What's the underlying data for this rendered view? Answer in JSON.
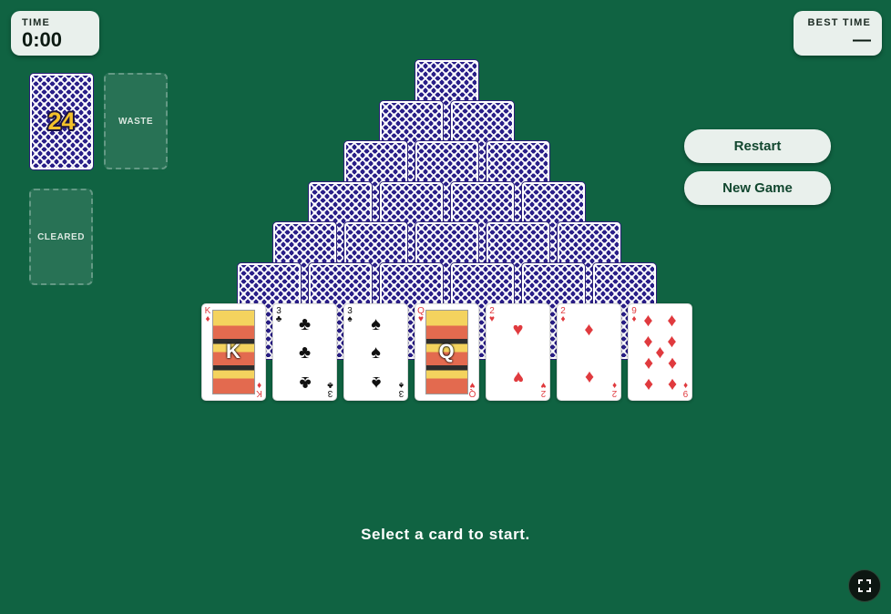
{
  "timer": {
    "label": "TIME",
    "value": "0:00"
  },
  "best_time": {
    "label": "BEST TIME",
    "value": "—"
  },
  "stock": {
    "count": "24"
  },
  "slots": {
    "waste": "WASTE",
    "cleared": "CLEARED"
  },
  "buttons": {
    "restart": "Restart",
    "new_game": "New Game"
  },
  "pyramid": {
    "rows_face_down": 6
  },
  "bottom_row": [
    {
      "rank": "K",
      "suit": "♦",
      "color": "red"
    },
    {
      "rank": "3",
      "suit": "♣",
      "color": "black"
    },
    {
      "rank": "3",
      "suit": "♠",
      "color": "black"
    },
    {
      "rank": "Q",
      "suit": "♥",
      "color": "red"
    },
    {
      "rank": "2",
      "suit": "♥",
      "color": "red"
    },
    {
      "rank": "2",
      "suit": "♦",
      "color": "red"
    },
    {
      "rank": "9",
      "suit": "♦",
      "color": "red"
    }
  ],
  "status_message": "Select a card to start.",
  "colors": {
    "felt": "#106342",
    "card_back": "#2a1f88",
    "stock_count": "#f3c22a",
    "button_text": "#12472f"
  },
  "icons": {
    "fullscreen": "fullscreen-icon"
  }
}
